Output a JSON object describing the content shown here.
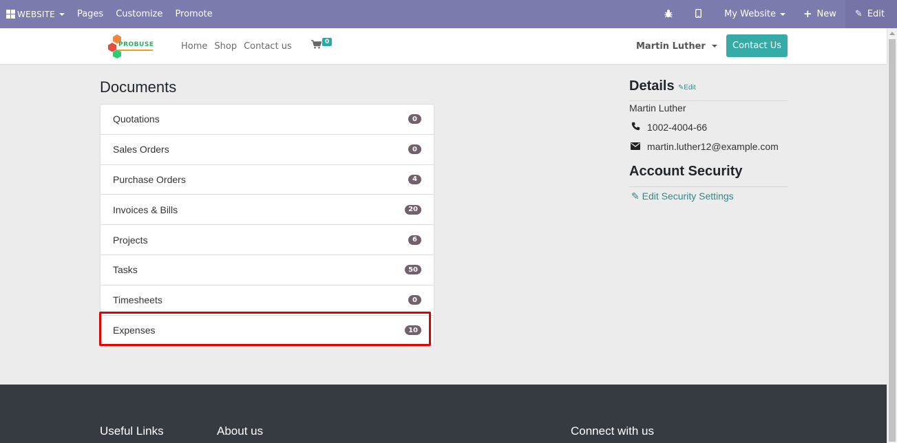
{
  "editbar": {
    "website_label": "WEBSITE",
    "pages_label": "Pages",
    "customize_label": "Customize",
    "promote_label": "Promote",
    "my_website_label": "My Website",
    "new_label": "New",
    "edit_label": "Edit"
  },
  "header": {
    "logo_text": "PROBUSE",
    "nav": [
      "Home",
      "Shop",
      "Contact us"
    ],
    "cart_count": "0",
    "user_name": "Martin Luther",
    "contact_button": "Contact Us"
  },
  "documents": {
    "title": "Documents",
    "items": [
      {
        "label": "Quotations",
        "count": "0"
      },
      {
        "label": "Sales Orders",
        "count": "0"
      },
      {
        "label": "Purchase Orders",
        "count": "4"
      },
      {
        "label": "Invoices & Bills",
        "count": "20"
      },
      {
        "label": "Projects",
        "count": "6"
      },
      {
        "label": "Tasks",
        "count": "50"
      },
      {
        "label": "Timesheets",
        "count": "0"
      },
      {
        "label": "Expenses",
        "count": "10"
      }
    ],
    "highlighted": "Expenses"
  },
  "details": {
    "title": "Details",
    "edit_label": "Edit",
    "name": "Martin Luther",
    "phone": "1002-4004-66",
    "email": "martin.luther12@example.com"
  },
  "security": {
    "title": "Account Security",
    "link": "Edit Security Settings"
  },
  "footer": {
    "useful_links": "Useful Links",
    "about_us": "About us",
    "connect": "Connect with us"
  },
  "colors": {
    "editbar": "#7c7bad",
    "accent": "#35aba7",
    "badge": "#72606c",
    "highlight": "#e30000",
    "footer": "#363b42"
  }
}
